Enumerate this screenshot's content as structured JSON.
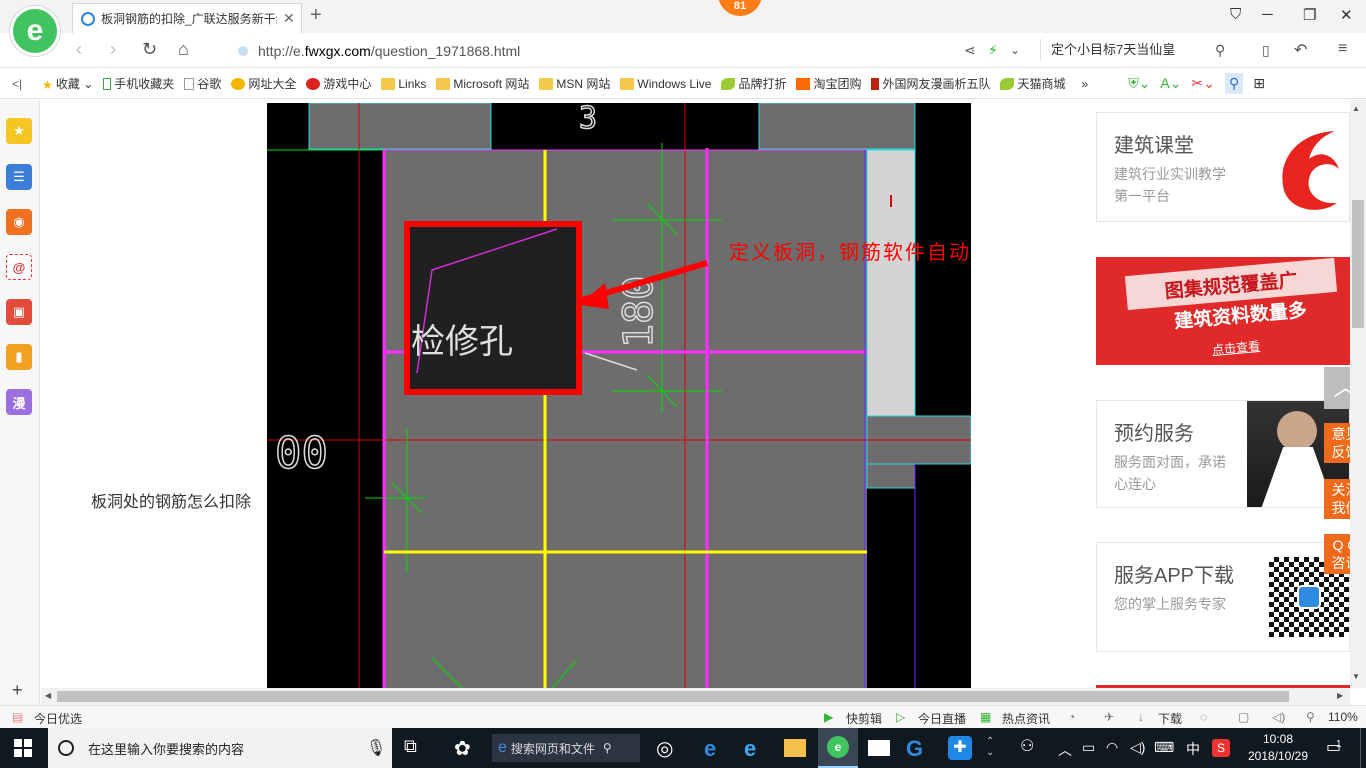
{
  "browser": {
    "badge": "81",
    "tab_title": "板洞钢筋的扣除_广联达服务新干线",
    "url_prefix": "http://e.",
    "url_domain": "fwxgx.com",
    "url_path": "/question_1971868.html",
    "search_text": "定个小目标7天当仙皇",
    "bookmarks": [
      "收藏",
      "手机收藏夹",
      "谷歌",
      "网址大全",
      "游戏中心",
      "Links",
      "Microsoft 网站",
      "MSN 网站",
      "Windows Live",
      "品牌打折",
      "淘宝团购",
      "外国网友漫画析五队",
      "天猫商城"
    ],
    "more_bookmarks": "»",
    "sidebar_icons": [
      "star-icon",
      "news-icon",
      "weibo-icon",
      "mail-icon",
      "game-icon",
      "book-icon",
      "comic-icon"
    ],
    "sidebar_comic_label": "漫",
    "sidebar_add": "+"
  },
  "page": {
    "question_text": "板洞处的钢筋怎么扣除",
    "cad_annotation": "定义板洞，钢筋软件自动扣减的",
    "cad_labels": {
      "hole_text": "检修孔",
      "dim_180": "180",
      "dim_00": "00",
      "top_num": "3"
    },
    "right_cards": [
      {
        "title": "建筑课堂",
        "desc": "建筑行业实训教学第一平台"
      },
      {
        "banner_line1": "图集规范覆盖广",
        "banner_line2": "建筑资料数量多",
        "banner_cta": "点击查看"
      },
      {
        "title": "预约服务",
        "desc": "服务面对面，承诺心连心"
      },
      {
        "title": "服务APP下载",
        "desc": "您的掌上服务专家"
      }
    ],
    "float_buttons": [
      "意见\n反馈",
      "关注\n我们",
      "Q Q\n咨询"
    ],
    "float_top_icon": "︿"
  },
  "statusbar": {
    "left": "今日优选",
    "items": [
      "快剪辑",
      "今日直播",
      "热点资讯",
      "下载"
    ],
    "zoom": "110%"
  },
  "taskbar": {
    "search_placeholder": "在这里输入你要搜索的内容",
    "browser_search": "搜索网页和文件",
    "time": "10:08",
    "date": "2018/10/29",
    "ime": "中",
    "notif_count": "1"
  },
  "colors": {
    "accent_orange": "#f06a1c",
    "cad_red_box": "#ff0000",
    "cad_yellow": "#ffff00",
    "cad_magenta": "#ff2cff",
    "cad_green": "#00dd00",
    "cad_gray": "#6d6d6d"
  }
}
